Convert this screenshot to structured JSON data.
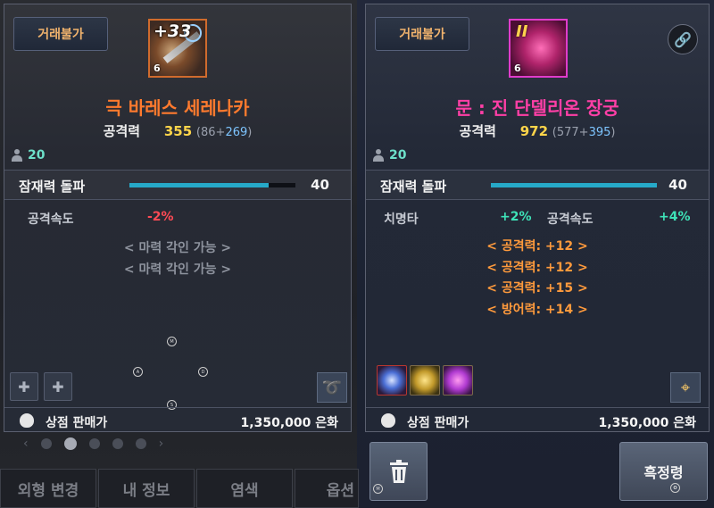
{
  "left_card": {
    "trade_label": "거래불가",
    "enhance": "+33",
    "tier": "6",
    "name": "극 바레스 세레나카",
    "name_color": "#ff7a2e",
    "attack_label": "공격력",
    "attack_value": "355",
    "attack_base": "(86+",
    "attack_bonus": "269",
    "attack_close": ")",
    "level": "20",
    "potential_label": "잠재력 돌파",
    "potential_value": "40",
    "potential_fill": 0.84,
    "stat1_label": "공격속도",
    "stat1_value": "-2%",
    "engrave1": "< 마력 각인 가능 >",
    "engrave2": "< 마력 각인 가능 >",
    "sell_label": "상점 판매가",
    "sell_value": "1,350,000 은화"
  },
  "right_card": {
    "trade_label": "거래불가",
    "enhance": "II",
    "tier": "6",
    "name": "문 : 진 단델리온 장궁",
    "name_color": "#ff3fa6",
    "attack_label": "공격력",
    "attack_value": "972",
    "attack_base": "(577+",
    "attack_bonus": "395",
    "attack_close": ")",
    "level": "20",
    "potential_label": "잠재력 돌파",
    "potential_value": "40",
    "potential_fill": 1.0,
    "stat1_label": "치명타",
    "stat1_value": "+2%",
    "stat2_label": "공격속도",
    "stat2_value": "+4%",
    "engraved": [
      "< 공격력: +12 >",
      "< 공격력: +12 >",
      "< 공격력: +15 >",
      "< 방어력: +14 >"
    ],
    "sell_label": "상점 판매가",
    "sell_value": "1,350,000 은화",
    "link_icon": "link-icon"
  },
  "bottom_tabs": [
    "외형 변경",
    "내 정보",
    "염색",
    "옵션"
  ],
  "shatter_label": "흑정령",
  "gamepad_hints": [
    "M",
    "A",
    "D",
    "S"
  ],
  "colors": {
    "accent_blue": "#26a9c8",
    "gold": "#ffd54a",
    "engraved_orange": "#ff9a3c",
    "negative": "#ff4a55",
    "positive": "#3ee3b8"
  }
}
